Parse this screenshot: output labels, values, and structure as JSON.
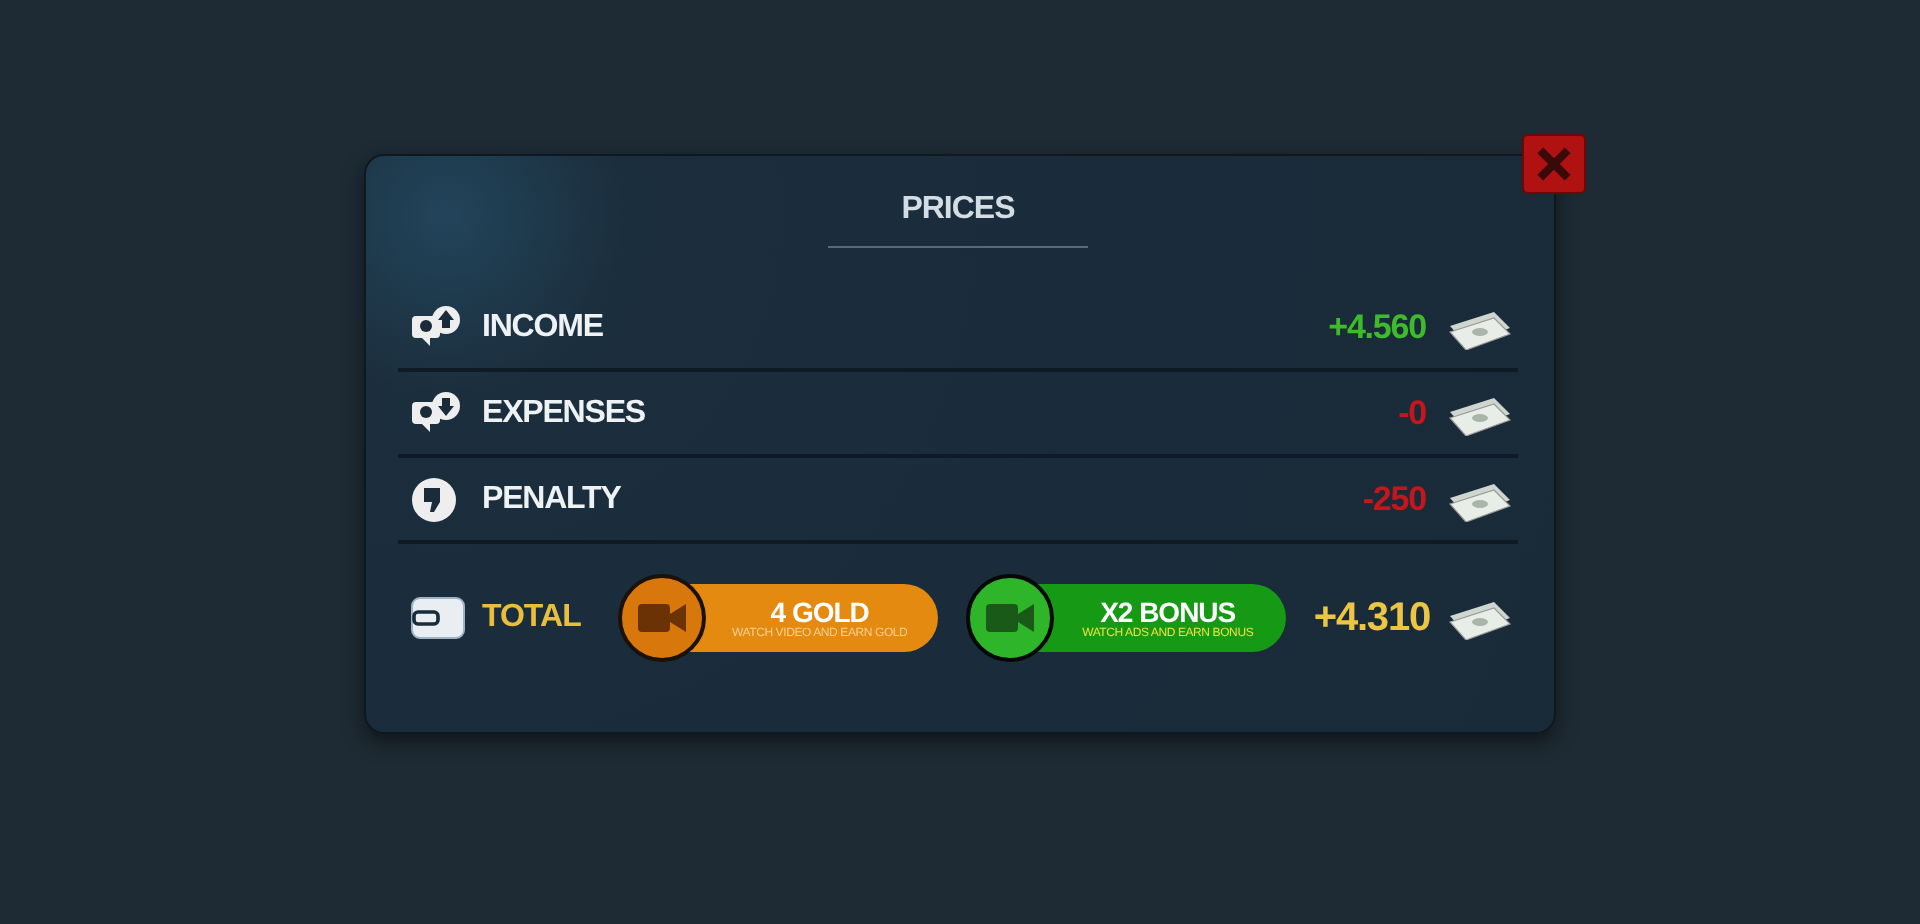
{
  "dialog": {
    "title": "PRICES"
  },
  "rows": [
    {
      "kind": "income",
      "label": "INCOME",
      "value": "+4.560",
      "color": "#3dbb2a"
    },
    {
      "kind": "expenses",
      "label": "EXPENSES",
      "value": "-0",
      "color": "#c4161c"
    },
    {
      "kind": "penalty",
      "label": "PENALTY",
      "value": "-250",
      "color": "#c4161c"
    }
  ],
  "total": {
    "label": "TOTAL",
    "value": "+4.310",
    "buttons": [
      {
        "kind": "gold",
        "label": "4 GOLD",
        "caption": "WATCH VIDEO AND EARN GOLD"
      },
      {
        "kind": "bonus",
        "label": "X2 BONUS",
        "caption": "WATCH ADS AND EARN BONUS"
      }
    ]
  }
}
